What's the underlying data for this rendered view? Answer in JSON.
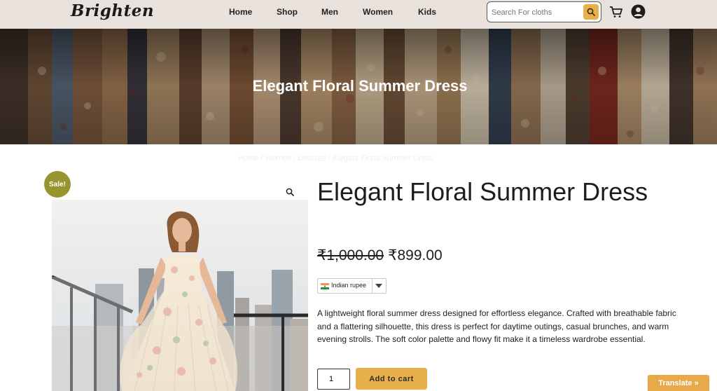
{
  "header": {
    "logo": "Brighten",
    "nav": [
      "Home",
      "Shop",
      "Men",
      "Women",
      "Kids"
    ],
    "search_placeholder": "Search For cloths"
  },
  "hero": {
    "title": "Elegant Floral Summer Dress"
  },
  "breadcrumb": "Home / Women / Dresses / Elegant Floral Summer Dress",
  "product": {
    "sale_badge": "Sale!",
    "title": "Elegant Floral Summer Dress",
    "old_price": "₹1,000.00",
    "price": "₹899.00",
    "currency": "Indian rupee",
    "description": "A lightweight floral summer dress designed for effortless elegance. Crafted with breathable fabric and a flattering silhouette, this dress is perfect for daytime outings, casual brunches, and warm evening strolls. The soft color palette and flowy fit make it a timeless wardrobe essential.",
    "quantity": "1",
    "add_to_cart": "Add to cart"
  },
  "translate_label": "Translate »",
  "colors": {
    "accent": "#e7b04c",
    "sale": "#98942f",
    "header_bg": "#e9e2dc"
  },
  "icons": {
    "search": "search-icon",
    "cart": "cart-icon",
    "account": "account-icon",
    "zoom": "zoom-icon",
    "currency_flag": "india-flag-icon"
  }
}
